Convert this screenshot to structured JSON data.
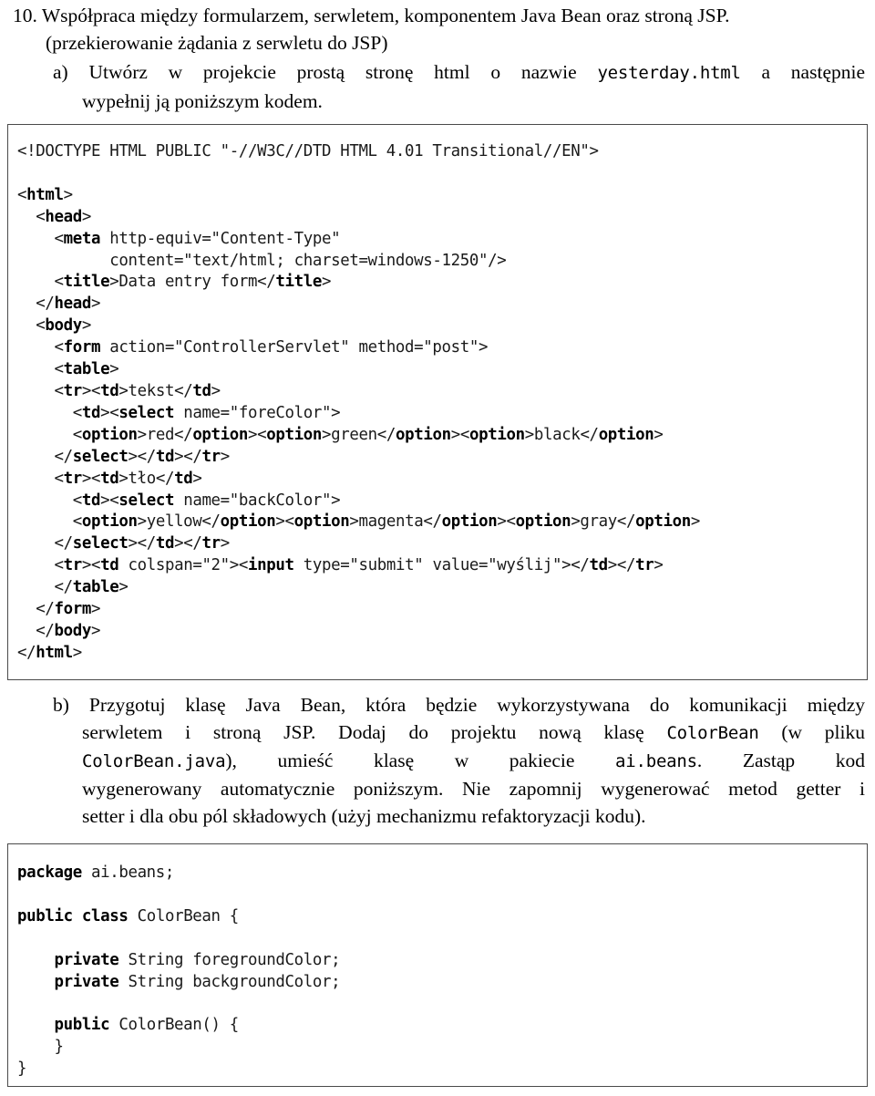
{
  "document": {
    "heading": {
      "number": "10.",
      "line1": "Współpraca między formularzem, serwletem, komponentem Java Bean oraz stroną JSP.",
      "line2": "(przekierowanie żądania z serwletu do JSP)"
    },
    "task_a": {
      "marker": "a)",
      "line1_before_code": "Utwórz w projekcie prostą stronę html o nazwie ",
      "line1_code": "yesterday.html",
      "line1_after_code": " a następnie",
      "line2": "wypełnij ją poniższym kodem."
    },
    "task_b": {
      "marker": "b)",
      "line1": "Przygotuj klasę Java Bean, która będzie wykorzystywana do komunikacji między",
      "line2_a": "serwletem i stroną JSP. Dodaj do projektu nową klasę ",
      "line2_code": "ColorBean",
      "line2_b": " (w pliku",
      "line3_code": "ColorBean.java",
      "line3_a": "), umieść klasę w pakiecie ",
      "line3_code2": "ai.beans",
      "line3_b": ". Zastąp kod",
      "line4": "wygenerowany automatycznie poniższym. Nie zapomnij wygenerować metod getter i",
      "line5": "setter i dla obu pól składowych (użyj mechanizmu refaktoryzacji kodu)."
    }
  },
  "code_blocks": {
    "html_listing": {
      "language": "html",
      "lines": [
        "<!DOCTYPE HTML PUBLIC \"-//W3C//DTD HTML 4.01 Transitional//EN\">",
        "",
        "<html>",
        "  <head>",
        "    <meta http-equiv=\"Content-Type\"",
        "          content=\"text/html; charset=windows-1250\"/>",
        "    <title>Data entry form</title>",
        "  </head>",
        "  <body>",
        "    <form action=\"ControllerServlet\" method=\"post\">",
        "    <table>",
        "    <tr><td>tekst</td>",
        "      <td><select name=\"foreColor\">",
        "      <option>red</option><option>green</option><option>black</option>",
        "    </select></td></tr>",
        "    <tr><td>tło</td>",
        "      <td><select name=\"backColor\">",
        "      <option>yellow</option><option>magenta</option><option>gray</option>",
        "    </select></td></tr>",
        "    <tr><td colspan=\"2\"><input type=\"submit\" value=\"wyślij\"></td></tr>",
        "    </table>",
        "  </form>",
        "  </body>",
        "</html>"
      ],
      "bold_tokens": [
        "html",
        "head",
        "meta",
        "title",
        "body",
        "form",
        "table",
        "tr",
        "td",
        "select",
        "option",
        "input"
      ]
    },
    "java_listing": {
      "language": "java",
      "lines": [
        "package ai.beans;",
        "",
        "public class ColorBean {",
        "",
        "    private String foregroundColor;",
        "    private String backgroundColor;",
        "",
        "    public ColorBean() {",
        "    }",
        "}"
      ],
      "bold_tokens": [
        "package",
        "public",
        "class",
        "private"
      ]
    }
  },
  "colors": {
    "text": "#000000",
    "code_text": "#1a1a1a",
    "box_border": "#4a4a4a",
    "background": "#ffffff"
  }
}
